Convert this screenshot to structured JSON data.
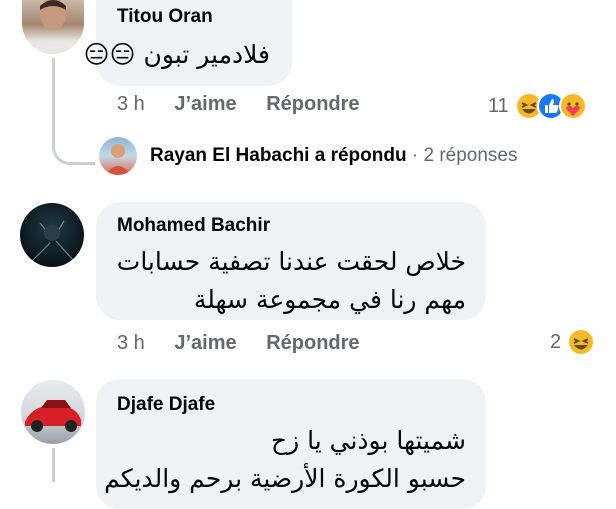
{
  "comments": [
    {
      "author": "Titou Oran",
      "text": "فلادمير تبون 😑😑",
      "time": "3 h",
      "like_label": "J’aime",
      "reply_label": "Répondre",
      "reaction_count": "11",
      "reactions": [
        "haha",
        "like",
        "love"
      ]
    },
    {
      "author": "Mohamed Bachir",
      "text_line1": "خلاص لحقت عندنا تصفية حسابات",
      "text_line2": "مهم رنا في مجموعة سهلة",
      "time": "3 h",
      "like_label": "J’aime",
      "reply_label": "Répondre",
      "reaction_count": "2",
      "reactions": [
        "haha"
      ]
    },
    {
      "author": "Djafe Djafe",
      "text_line1": "شميتها بوذني يا زح",
      "text_line2": "حسبو الكورة الأرضية برحم والديكم"
    }
  ],
  "reply_summary": {
    "author": "Rayan El Habachi",
    "action": "a répondu",
    "separator": "·",
    "count": "2 réponses"
  },
  "colors": {
    "bubble": "#f0f2f5",
    "meta": "#65676b",
    "thread_line": "#ccd0d5",
    "like_blue": "#1877f2",
    "haha_yellow": "#f7b928",
    "love_red": "#f33e58"
  }
}
